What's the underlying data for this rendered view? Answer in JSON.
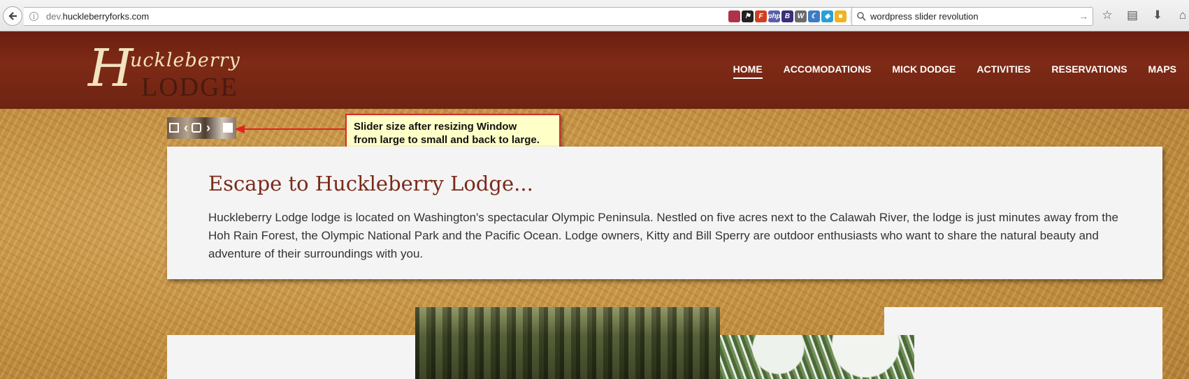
{
  "browser": {
    "url_prefix": "dev.",
    "url_domain": "huckleberryforks.com",
    "search_text": "wordpress slider revolution",
    "addons": [
      {
        "icon": "feather-icon",
        "label": "",
        "color": "#b0314a"
      },
      {
        "icon": "flag-icon",
        "label": "⚑",
        "color": "#222222"
      },
      {
        "icon": "firebug-icon",
        "label": "F",
        "color": "#d04020"
      },
      {
        "icon": "php-icon",
        "label": "php",
        "color": "#5b5fa8"
      },
      {
        "icon": "bootstrap-icon",
        "label": "B",
        "color": "#3a2f7a"
      },
      {
        "icon": "wordpress-icon",
        "label": "W",
        "color": "#6b6b6b"
      },
      {
        "icon": "moon-icon",
        "label": "☾",
        "color": "#3d7bc4"
      },
      {
        "icon": "chat-icon",
        "label": "◆",
        "color": "#2a9fd8"
      },
      {
        "icon": "cube-icon",
        "label": "■",
        "color": "#f2b321"
      }
    ]
  },
  "site": {
    "logo_initial": "H",
    "logo_top": "uckleberry",
    "logo_bottom": "LODGE",
    "nav": [
      "HOME",
      "ACCOMODATIONS",
      "MICK DODGE",
      "ACTIVITIES",
      "RESERVATIONS",
      "MAPS"
    ],
    "active_nav": "HOME"
  },
  "annotation": {
    "line1": "Slider size after resizing Window",
    "line2": "from large to small and back to large."
  },
  "content": {
    "title": "Escape to Huckleberry Lodge...",
    "body": "Huckleberry Lodge lodge is located on Washington's spectacular Olympic Peninsula. Nestled on five acres next to the Calawah River, the lodge is just minutes away from the Hoh Rain Forest, the Olympic National Park and the Pacific Ocean. Lodge owners, Kitty and Bill Sperry are outdoor enthusiasts who want to share the natural beauty and adventure of their surroundings with you."
  },
  "colors": {
    "header_brown": "#7e2a16",
    "gold": "#c68f3d",
    "heading_red": "#7a2a1a",
    "note_bg": "#ffffc8",
    "note_border": "#d92a2a"
  }
}
